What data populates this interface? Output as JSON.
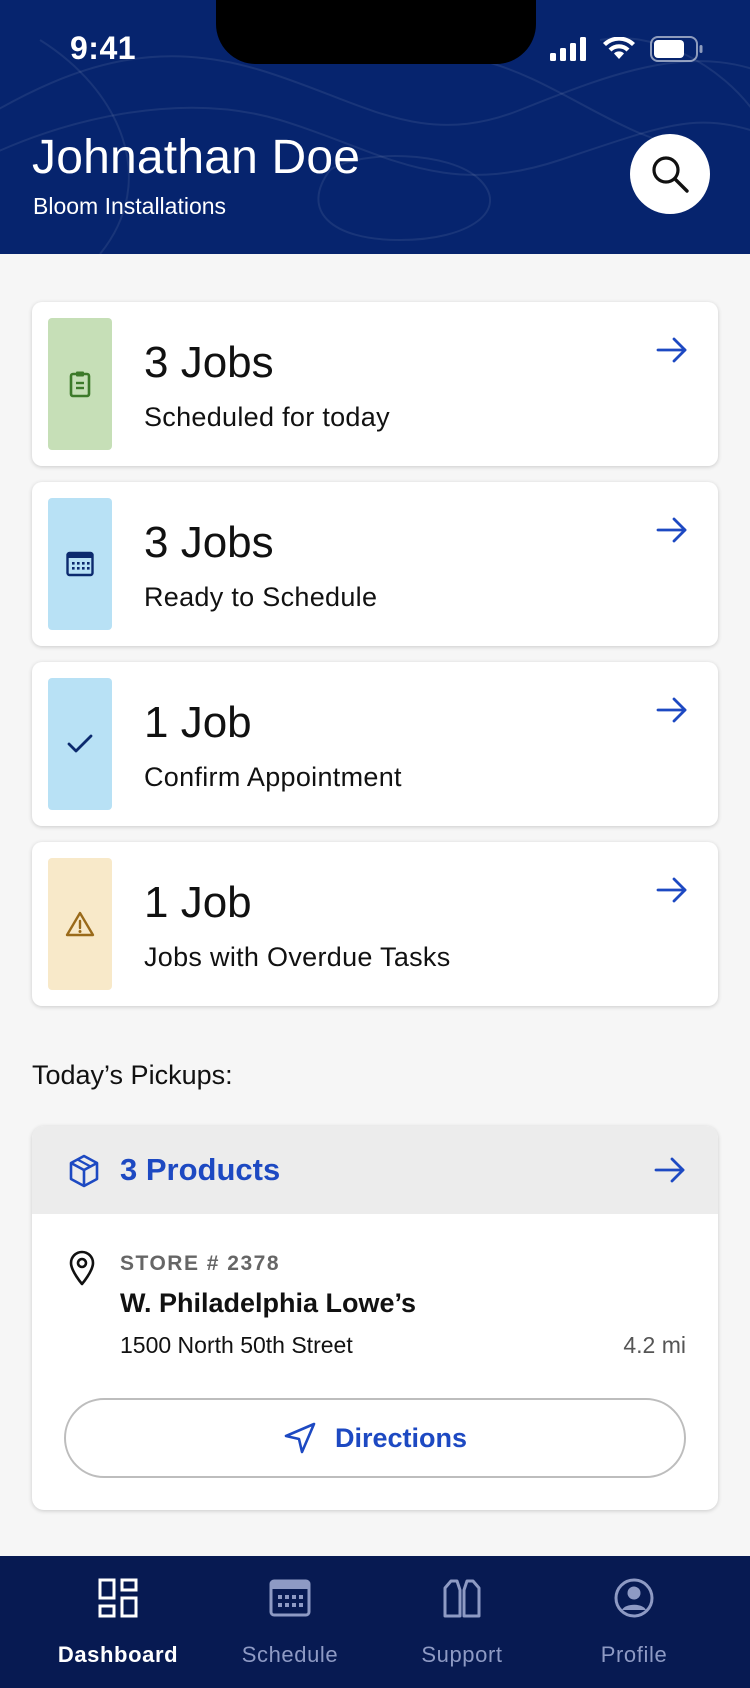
{
  "status_bar": {
    "time": "9:41"
  },
  "header": {
    "user_name": "Johnathan Doe",
    "company": "Bloom Installations",
    "search_icon": "search-icon"
  },
  "job_cards": [
    {
      "count": "3 Jobs",
      "description": "Scheduled for today",
      "icon": "clipboard-icon",
      "accent": "#c6dfb7",
      "icon_color": "#3d7a2a"
    },
    {
      "count": "3 Jobs",
      "description": "Ready to Schedule",
      "icon": "calendar-icon",
      "accent": "#b8e1f5",
      "icon_color": "#0c2a6e"
    },
    {
      "count": "1 Job",
      "description": "Confirm Appointment",
      "icon": "check-icon",
      "accent": "#b8e1f5",
      "icon_color": "#0c2a6e"
    },
    {
      "count": "1 Job",
      "description": "Jobs with Overdue Tasks",
      "icon": "warning-icon",
      "accent": "#f8e9c9",
      "icon_color": "#9a6a1a"
    }
  ],
  "pickups": {
    "title": "Today’s Pickups:",
    "products_label": "3 Products",
    "store_number": "STORE # 2378",
    "store_name": "W. Philadelphia Lowe’s",
    "address": "1500 North 50th Street",
    "distance": "4.2 mi",
    "directions_label": "Directions"
  },
  "bottom_nav": [
    {
      "label": "Dashboard",
      "icon": "dashboard-icon",
      "active": true
    },
    {
      "label": "Schedule",
      "icon": "calendar-icon",
      "active": false
    },
    {
      "label": "Support",
      "icon": "support-icon",
      "active": false
    },
    {
      "label": "Profile",
      "icon": "profile-icon",
      "active": false
    }
  ],
  "colors": {
    "header_bg": "#06246e",
    "nav_bg": "#071a52",
    "accent_blue": "#1d49c2",
    "page_bg": "#f6f6f6"
  }
}
